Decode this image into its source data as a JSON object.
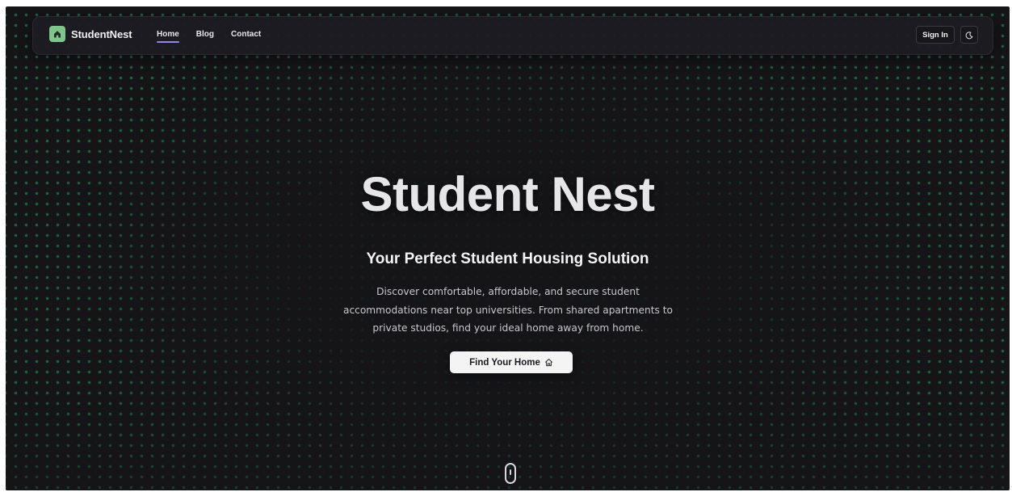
{
  "nav": {
    "brand": "StudentNest",
    "links": [
      "Home",
      "Blog",
      "Contact"
    ],
    "active_link": "Home",
    "sign_in_label": "Sign In",
    "theme_toggle_icon": "moon-icon",
    "logo_icon": "house-icon"
  },
  "hero": {
    "title": "Student Nest",
    "subtitle": "Your Perfect Student Housing Solution",
    "description": "Discover comfortable, affordable, and secure student accommodations near top universities. From shared apartments to private studios, find your ideal home away from home.",
    "cta_label": "Find Your Home",
    "cta_icon": "home-icon"
  },
  "scroll_indicator_icon": "mouse-scroll-icon",
  "colors": {
    "background": "#151518",
    "dot_grid": "#28a064",
    "logo_accent": "#7fc48b",
    "active_underline": "#8d88e6",
    "cta_background": "#f4f4f5"
  }
}
